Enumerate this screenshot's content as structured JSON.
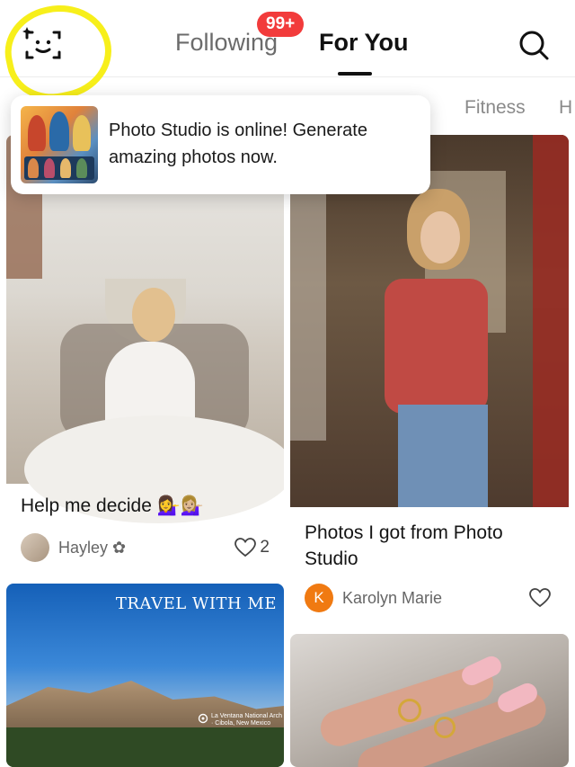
{
  "header": {
    "tabs": [
      {
        "label": "Following",
        "active": false
      },
      {
        "label": "For You",
        "active": true
      }
    ],
    "notification_badge": "99+",
    "scan_icon": "face-scan-icon",
    "search_icon": "search-icon"
  },
  "categories": [
    "Fitness",
    "H"
  ],
  "tooltip": {
    "text": "Photo Studio is online! Generate amazing photos now."
  },
  "feed": {
    "left": [
      {
        "title": "Help me decide 💁‍♀️💁🏼‍♀️",
        "author": "Hayley ✿",
        "likes": "2",
        "image_text": ""
      },
      {
        "title": "",
        "author": "",
        "likes": "",
        "image_text": "TRAVEL WITH ME",
        "location_text": "La Ventana National Arch · Cibola, New Mexico"
      }
    ],
    "right": [
      {
        "title": "Photos I got from Photo Studio",
        "author": "Karolyn Marie",
        "avatar_letter": "K",
        "likes": ""
      },
      {
        "title": "",
        "author": "",
        "likes": ""
      }
    ]
  },
  "colors": {
    "accent_red": "#f23b3b",
    "highlight_yellow": "#f7ef1b",
    "avatar_orange": "#f07a12"
  }
}
